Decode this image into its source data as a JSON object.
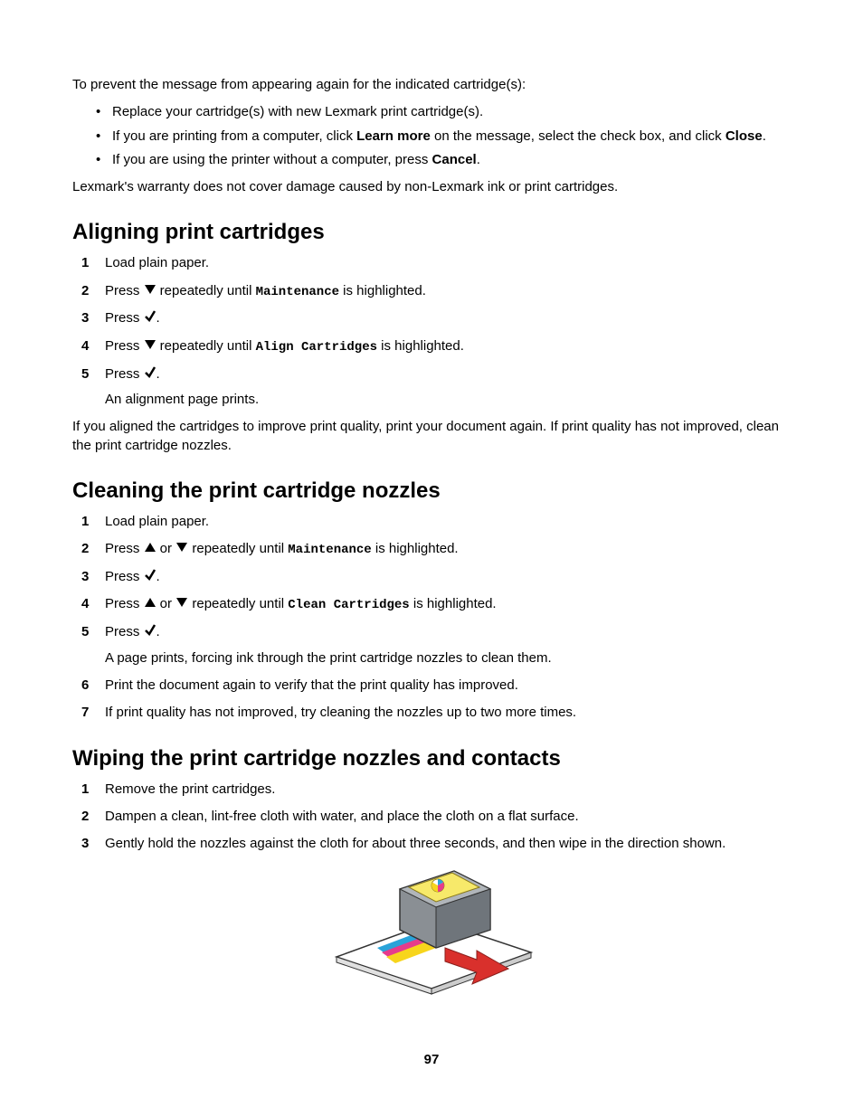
{
  "intro": {
    "prevent_text": "To prevent the message from appearing again for the indicated cartridge(s):",
    "bullets": [
      {
        "text": "Replace your cartridge(s) with new Lexmark print cartridge(s)."
      },
      {
        "pre": "If you are printing from a computer, click ",
        "b1": "Learn more",
        "mid": " on the message, select the check box, and click ",
        "b2": "Close",
        "post": "."
      },
      {
        "pre": "If you are using the printer without a computer, press ",
        "b1": "Cancel",
        "post": "."
      }
    ],
    "warranty": "Lexmark's warranty does not cover damage caused by non-Lexmark ink or print cartridges."
  },
  "aligning": {
    "heading": "Aligning print cartridges",
    "steps": {
      "s1": "Load plain paper.",
      "s2_pre": "Press ",
      "s2_mid": " repeatedly until ",
      "s2_mono": "Maintenance",
      "s2_post": " is highlighted.",
      "s3_pre": "Press ",
      "s3_post": ".",
      "s4_pre": "Press ",
      "s4_mid": " repeatedly until ",
      "s4_mono": "Align Cartridges",
      "s4_post": " is highlighted.",
      "s5_pre": "Press ",
      "s5_post": ".",
      "s5_sub": "An alignment page prints."
    },
    "after": "If you aligned the cartridges to improve print quality, print your document again. If print quality has not improved, clean the print cartridge nozzles."
  },
  "cleaning": {
    "heading": "Cleaning the print cartridge nozzles",
    "steps": {
      "s1": "Load plain paper.",
      "s2_pre": "Press ",
      "s2_or": " or ",
      "s2_mid": " repeatedly until ",
      "s2_mono": "Maintenance",
      "s2_post": " is highlighted.",
      "s3_pre": "Press ",
      "s3_post": ".",
      "s4_pre": "Press ",
      "s4_or": " or ",
      "s4_mid": " repeatedly until ",
      "s4_mono": "Clean Cartridges",
      "s4_post": " is highlighted.",
      "s5_pre": "Press ",
      "s5_post": ".",
      "s5_sub": "A page prints, forcing ink through the print cartridge nozzles to clean them.",
      "s6": "Print the document again to verify that the print quality has improved.",
      "s7": "If print quality has not improved, try cleaning the nozzles up to two more times."
    }
  },
  "wiping": {
    "heading": "Wiping the print cartridge nozzles and contacts",
    "steps": {
      "s1": "Remove the print cartridges.",
      "s2": "Dampen a clean, lint-free cloth with water, and place the cloth on a flat surface.",
      "s3": "Gently hold the nozzles against the cloth for about three seconds, and then wipe in the direction shown."
    }
  },
  "page_number": "97"
}
